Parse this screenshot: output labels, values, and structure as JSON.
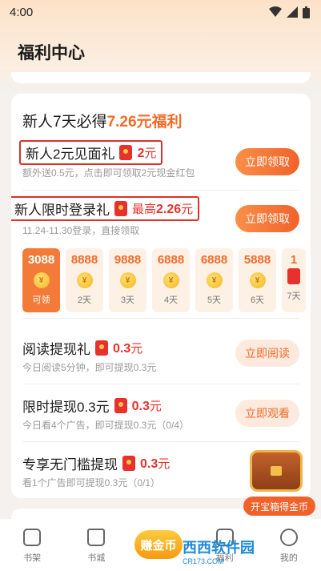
{
  "status": {
    "time": "4:00"
  },
  "header": {
    "title": "福利中心"
  },
  "section": {
    "headline_prefix": "新人7天必得",
    "headline_accent": "7.26元福利"
  },
  "rows": [
    {
      "title": "新人2元见面礼",
      "amount": "2",
      "unit": "元",
      "sub": "额外送0.5元，点击即可领取2元现金红包",
      "button": "立即领取"
    },
    {
      "title": "新人限时登录礼",
      "amount_prefix": "最高",
      "amount": "2.26",
      "unit": "元",
      "sub": "11.24-11.30登录，直接领取",
      "button": "立即领取"
    },
    {
      "title": "阅读提现礼",
      "amount": "0.3",
      "unit": "元",
      "sub": "今日阅读5分钟，即可提现0.3元",
      "button": "立即阅读"
    },
    {
      "title": "限时提现0.3元",
      "amount": "0.3",
      "unit": "元",
      "sub": "今日看4个广告，即可提现0.3元（0/4）",
      "button": "立即观看"
    },
    {
      "title": "专享无门槛提现",
      "amount": "0.3",
      "unit": "元",
      "sub": "看1个广告即可提现0.3元（0/1）"
    }
  ],
  "days": [
    {
      "value": "3088",
      "label": "可领"
    },
    {
      "value": "8888",
      "label": "2天"
    },
    {
      "value": "9888",
      "label": "3天"
    },
    {
      "value": "6888",
      "label": "4天"
    },
    {
      "value": "6888",
      "label": "5天"
    },
    {
      "value": "5888",
      "label": "6天"
    },
    {
      "value": "1",
      "label": "7天"
    }
  ],
  "chest": {
    "label": "开宝箱得金币"
  },
  "tabbar": {
    "bookshelf": "书架",
    "bookcity": "书城",
    "earn": "赚金币",
    "welfare": "福利",
    "mine": "我的"
  },
  "watermark": {
    "text": "西西软件园",
    "sub": "CR173.COM"
  },
  "colors": {
    "accent": "#f26b2a",
    "red": "#e8312d"
  }
}
